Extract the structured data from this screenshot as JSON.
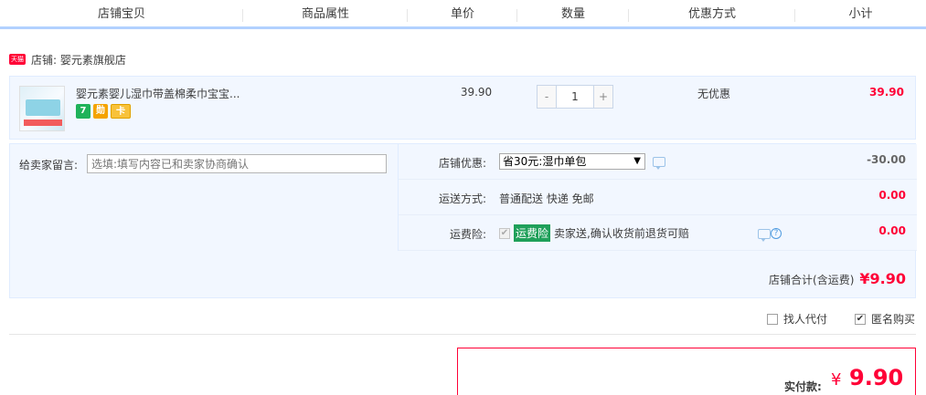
{
  "header": {
    "columns": [
      "店铺宝贝",
      "商品属性",
      "单价",
      "数量",
      "优惠方式",
      "小计"
    ]
  },
  "shop": {
    "tmall_badge": "天猫",
    "label": "店铺: 婴元素旗舰店"
  },
  "item": {
    "title": "婴元素婴儿湿巾带盖棉柔巾宝宝...",
    "badges": [
      "7",
      "勋",
      "卡"
    ],
    "unit_price": "39.90",
    "quantity": "1",
    "qty_minus": "-",
    "qty_plus": "+",
    "promotion": "无优惠",
    "subtotal": "39.90"
  },
  "message": {
    "label": "给卖家留言:",
    "placeholder": "选填:填写内容已和卖家协商确认"
  },
  "discount": {
    "label": "店铺优惠:",
    "selected": "省30元:湿巾单包",
    "amount": "-30.00"
  },
  "shipping": {
    "label": "运送方式:",
    "method": "普通配送 快递 免邮",
    "amount": "0.00"
  },
  "insurance": {
    "label": "运费险:",
    "tag": "运费险",
    "text": "卖家送,确认收货前退货可赔",
    "amount": "0.00",
    "help": "?"
  },
  "shop_total": {
    "label": "店铺合计(含运费)",
    "value": "¥9.90"
  },
  "options": {
    "proxy_pay": "找人代付",
    "anonymous": "匿名购买"
  },
  "payment": {
    "label": "实付款:",
    "currency": "¥",
    "value": "9.90"
  },
  "colors": {
    "accent": "#ff0036",
    "header_border": "#b2d1ff",
    "panel_bg": "#f2f7ff"
  }
}
